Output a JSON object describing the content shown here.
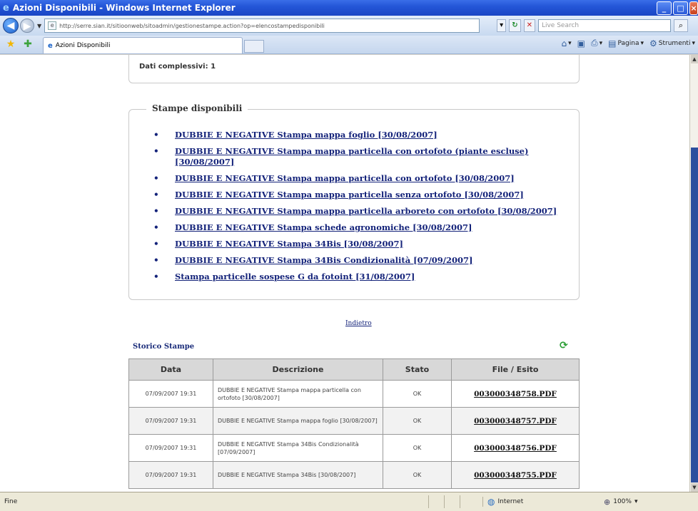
{
  "window": {
    "title": "Azioni Disponibili - Windows Internet Explorer",
    "icon": "ie-icon"
  },
  "address_bar": {
    "url": "http://serre.sian.it/sitioonweb/sitoadmin/gestionestampe.action?op=elencostampedisponibili",
    "search_placeholder": "Live Search"
  },
  "tabs": [
    {
      "label": "Azioni Disponibili"
    }
  ],
  "tab_tools": {
    "page_label": "Pagina",
    "tools_label": "Strumenti"
  },
  "top_box": {
    "partial_label": "Dati complessivi: 1"
  },
  "stampe_disponibili": {
    "legend": "Stampe disponibili",
    "items": [
      "DUBBIE E NEGATIVE Stampa mappa foglio [30/08/2007]",
      "DUBBIE E NEGATIVE Stampa mappa particella con ortofoto (piante escluse) [30/08/2007]",
      "DUBBIE E NEGATIVE Stampa mappa particella con ortofoto [30/08/2007]",
      "DUBBIE E NEGATIVE Stampa mappa particella senza ortofoto [30/08/2007]",
      "DUBBIE E NEGATIVE Stampa mappa particella arboreto con ortofoto [30/08/2007]",
      "DUBBIE E NEGATIVE Stampa schede agronomiche [30/08/2007]",
      "DUBBIE E NEGATIVE Stampa 34Bis [30/08/2007]",
      "DUBBIE E NEGATIVE Stampa 34Bis Condizionalità [07/09/2007]",
      "Stampa particelle sospese G da fotoint [31/08/2007]"
    ]
  },
  "indietro_label": "Indietro",
  "storico": {
    "title": "Storico Stampe",
    "columns": [
      "Data",
      "Descrizione",
      "Stato",
      "File / Esito"
    ],
    "rows": [
      {
        "data": "07/09/2007 19:31",
        "descrizione": "DUBBIE E NEGATIVE Stampa mappa particella con ortofoto [30/08/2007]",
        "stato": "OK",
        "file": "003000348758.PDF"
      },
      {
        "data": "07/09/2007 19:31",
        "descrizione": "DUBBIE E NEGATIVE Stampa mappa foglio [30/08/2007]",
        "stato": "OK",
        "file": "003000348757.PDF"
      },
      {
        "data": "07/09/2007 19:31",
        "descrizione": "DUBBIE E NEGATIVE Stampa 34Bis Condizionalità [07/09/2007]",
        "stato": "OK",
        "file": "003000348756.PDF"
      },
      {
        "data": "07/09/2007 19:31",
        "descrizione": "DUBBIE E NEGATIVE Stampa 34Bis [30/08/2007]",
        "stato": "OK",
        "file": "003000348755.PDF"
      }
    ]
  },
  "status_bar": {
    "left_text": "Fine",
    "zone": "Internet",
    "zoom": "100%"
  }
}
